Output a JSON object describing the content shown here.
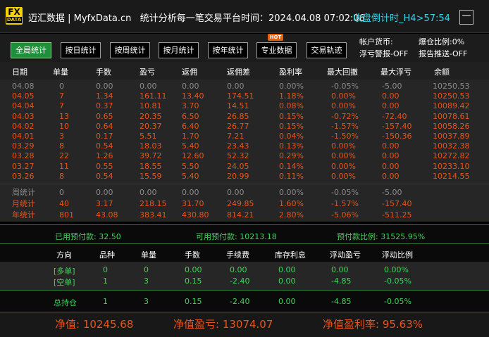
{
  "titlebar": {
    "logo_top": "FX",
    "logo_bottom": "DATA",
    "brand": "迈汇数据 | MyfxData.cn   统计分析每一笔交易",
    "platform_time": "平台时间：2024.04.08 07:02:06",
    "countdown": "收盘倒计时_H4>57:54",
    "minimize_label": "—"
  },
  "toolbar": {
    "buttons": [
      "全局统计",
      "按日统计",
      "按周统计",
      "按月统计",
      "按年统计",
      "专业数据",
      "交易轨迹"
    ],
    "active_index": 0,
    "hot_badge": "HOT",
    "account_currency": "帐户货币:",
    "margin_ratio": "爆仓比例:0%",
    "float_alert": "浮亏警报-OFF",
    "report_push": "报告推送-OFF"
  },
  "table": {
    "headers": [
      "日期",
      "单量",
      "手数",
      "盈亏",
      "返佣",
      "返佣差",
      "盈利率",
      "最大回撤",
      "最大浮亏",
      "余额"
    ],
    "rows": [
      {
        "cells": [
          "04.08",
          "0",
          "0.00",
          "0.00",
          "0.00",
          "0.00",
          "0.00%",
          "-0.05%",
          "-5.00",
          "10250.53"
        ],
        "tone": "gray"
      },
      {
        "cells": [
          "04.05",
          "7",
          "1.34",
          "161.11",
          "13.40",
          "174.51",
          "1.18%",
          "0.00%",
          "0.00",
          "10250.53"
        ],
        "tone": "red"
      },
      {
        "cells": [
          "04.04",
          "7",
          "0.37",
          "10.81",
          "3.70",
          "14.51",
          "0.08%",
          "0.00%",
          "0.00",
          "10089.42"
        ],
        "tone": "red"
      },
      {
        "cells": [
          "04.03",
          "13",
          "0.65",
          "20.35",
          "6.50",
          "26.85",
          "0.15%",
          "-0.72%",
          "-72.40",
          "10078.61"
        ],
        "tone": "red"
      },
      {
        "cells": [
          "04.02",
          "10",
          "0.64",
          "20.37",
          "6.40",
          "26.77",
          "0.15%",
          "-1.57%",
          "-157.40",
          "10058.26"
        ],
        "tone": "red"
      },
      {
        "cells": [
          "04.01",
          "3",
          "0.17",
          "5.51",
          "1.70",
          "7.21",
          "0.04%",
          "-1.50%",
          "-150.36",
          "10037.89"
        ],
        "tone": "red"
      },
      {
        "cells": [
          "03.29",
          "8",
          "0.54",
          "18.03",
          "5.40",
          "23.43",
          "0.13%",
          "0.00%",
          "0.00",
          "10032.38"
        ],
        "tone": "red"
      },
      {
        "cells": [
          "03.28",
          "22",
          "1.26",
          "39.72",
          "12.60",
          "52.32",
          "0.29%",
          "0.00%",
          "0.00",
          "10272.82"
        ],
        "tone": "red"
      },
      {
        "cells": [
          "03.27",
          "11",
          "0.55",
          "18.55",
          "5.50",
          "24.05",
          "0.14%",
          "0.00%",
          "0.00",
          "10233.10"
        ],
        "tone": "red"
      },
      {
        "cells": [
          "03.26",
          "8",
          "0.54",
          "15.59",
          "5.40",
          "20.99",
          "0.11%",
          "0.00%",
          "0.00",
          "10214.55"
        ],
        "tone": "red"
      }
    ],
    "summary": [
      {
        "cells": [
          "周统计",
          "0",
          "0.00",
          "0.00",
          "0.00",
          "0.00",
          "0.00%",
          "-0.05%",
          "-5.00"
        ],
        "tone": "gray"
      },
      {
        "cells": [
          "月统计",
          "40",
          "3.17",
          "218.15",
          "31.70",
          "249.85",
          "1.60%",
          "-1.57%",
          "-157.40"
        ],
        "tone": "red"
      },
      {
        "cells": [
          "年统计",
          "801",
          "43.08",
          "383.41",
          "430.80",
          "814.21",
          "2.80%",
          "-5.06%",
          "-511.25"
        ],
        "tone": "red"
      }
    ]
  },
  "usage": {
    "used_margin": "已用预付款: 32.50",
    "free_margin": "可用预付款: 10213.18",
    "margin_level": "预付款比例: 31525.95%"
  },
  "positions": {
    "headers": [
      "方向",
      "品种",
      "单量",
      "手数",
      "手续费",
      "库存利息",
      "浮动盈亏",
      "浮动比例"
    ],
    "rows": [
      [
        "[多单]",
        "0",
        "0",
        "0.00",
        "0.00",
        "0.00",
        "0.00",
        "0.00%"
      ],
      [
        "[空单]",
        "1",
        "3",
        "0.15",
        "-2.40",
        "0.00",
        "-4.85",
        "-0.05%"
      ]
    ],
    "total": [
      "总持仓",
      "1",
      "3",
      "0.15",
      "-2.40",
      "0.00",
      "-4.85",
      "-0.05%"
    ]
  },
  "bottom": {
    "equity": "净值: 10245.68",
    "equity_pl": "净值盈亏: 13074.07",
    "equity_rate": "净值盈利率: 95.63%"
  },
  "colors": {
    "red_text": "#e8541a",
    "gray_text": "#8a8a8a",
    "green_text": "#3fd45a",
    "cyan_text": "#33d6e8",
    "active_button": "#1e8f3a",
    "logo_yellow": "#f5d100"
  }
}
